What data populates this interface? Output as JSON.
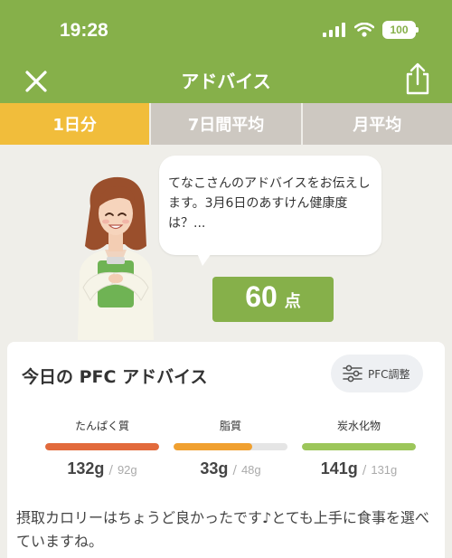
{
  "status": {
    "time": "19:28",
    "battery": "100"
  },
  "nav": {
    "title": "アドバイス",
    "close_icon": "close-icon",
    "share_icon": "share-icon"
  },
  "tabs": [
    {
      "label": "1日分",
      "active": true
    },
    {
      "label": "7日間平均",
      "active": false
    },
    {
      "label": "月平均",
      "active": false
    }
  ],
  "advice": {
    "message": "てなこさんのアドバイスをお伝えします。3月6日のあすけん健康度は？...",
    "score": "60",
    "score_unit": "点"
  },
  "card": {
    "title": "今日の PFC アドバイス",
    "pfc_button": "PFC調整",
    "nutrients": [
      {
        "name": "たんぱく質",
        "actual": "132g",
        "target": "92g",
        "fill_percent": 100,
        "color": "#e26a3c"
      },
      {
        "name": "脂質",
        "actual": "33g",
        "target": "48g",
        "fill_percent": 69,
        "color": "#f0a030"
      },
      {
        "name": "炭水化物",
        "actual": "141g",
        "target": "131g",
        "fill_percent": 100,
        "color": "#9cc65a"
      }
    ],
    "separator": "/",
    "text": "摂取カロリーはちょうど良かったです♪とても上手に食事を選べていますね。"
  },
  "colors": {
    "brand_green": "#86b04a",
    "tab_active": "#f1bd3b",
    "tab_inactive": "#cdc8c1"
  }
}
